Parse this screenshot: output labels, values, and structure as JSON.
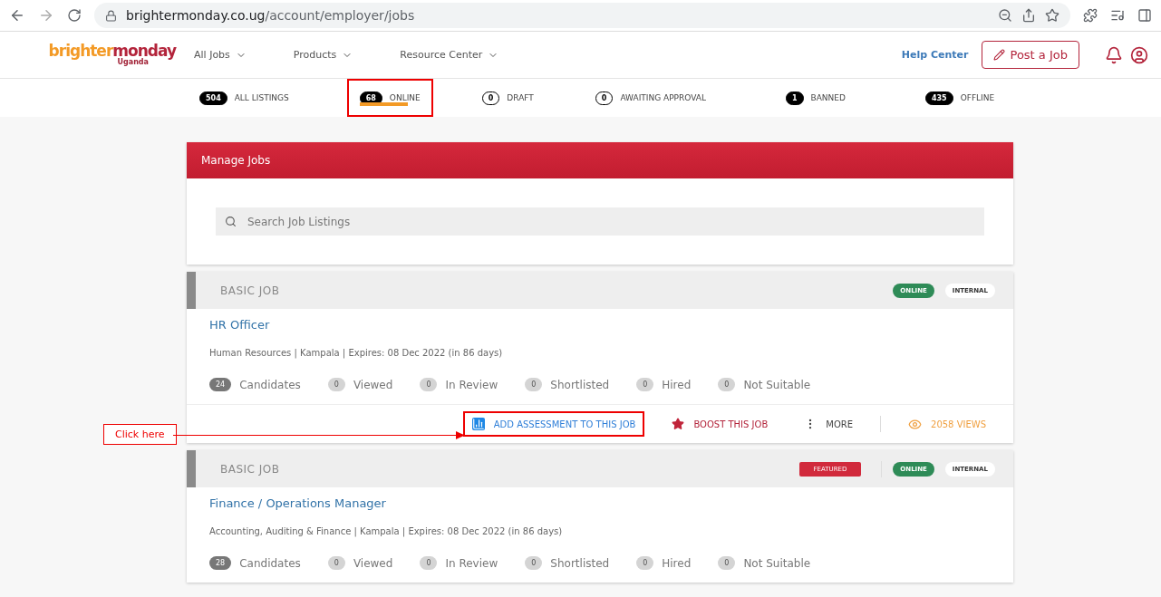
{
  "browser": {
    "url_host": "brightermonday.co.ug",
    "url_path": "/account/employer/jobs"
  },
  "header": {
    "logo": {
      "word1": "brighter",
      "word2": "monday",
      "sub": "Uganda"
    },
    "nav": [
      "All Jobs",
      "Products",
      "Resource Center"
    ],
    "help": "Help Center",
    "post_button": "Post a Job"
  },
  "tabs": [
    {
      "count": "504",
      "label": "ALL LISTINGS",
      "filled": true,
      "selected": false,
      "highlighted": false
    },
    {
      "count": "68",
      "label": "ONLINE",
      "filled": true,
      "selected": true,
      "highlighted": true
    },
    {
      "count": "0",
      "label": "DRAFT",
      "filled": false,
      "selected": false,
      "highlighted": false
    },
    {
      "count": "0",
      "label": "AWAITING APPROVAL",
      "filled": false,
      "selected": false,
      "highlighted": false
    },
    {
      "count": "1",
      "label": "BANNED",
      "filled": true,
      "selected": false,
      "highlighted": false
    },
    {
      "count": "435",
      "label": "OFFLINE",
      "filled": true,
      "selected": false,
      "highlighted": false
    }
  ],
  "manage": {
    "title": "Manage Jobs",
    "search_placeholder": "Search Job Listings"
  },
  "jobs": [
    {
      "type": "BASIC JOB",
      "featured": false,
      "status": "ONLINE",
      "visibility": "INTERNAL",
      "title": "HR Officer",
      "meta": "Human Resources | Kampala | Expires: 08 Dec 2022 (in 86 days)",
      "stats": [
        {
          "count": "24",
          "label": "Candidates",
          "dark": true
        },
        {
          "count": "0",
          "label": "Viewed",
          "dark": false
        },
        {
          "count": "0",
          "label": "In Review",
          "dark": false
        },
        {
          "count": "0",
          "label": "Shortlisted",
          "dark": false
        },
        {
          "count": "0",
          "label": "Hired",
          "dark": false
        },
        {
          "count": "0",
          "label": "Not Suitable",
          "dark": false
        }
      ],
      "actions": [
        {
          "kind": "assessment",
          "label": "ADD ASSESSMENT TO THIS JOB",
          "highlighted": true
        },
        {
          "kind": "boost",
          "label": "BOOST THIS JOB",
          "highlighted": false
        },
        {
          "kind": "more",
          "label": "MORE",
          "highlighted": false
        },
        {
          "kind": "views",
          "label": "2058 VIEWS",
          "highlighted": false
        }
      ]
    },
    {
      "type": "BASIC JOB",
      "featured": true,
      "featured_label": "FEATURED",
      "status": "ONLINE",
      "visibility": "INTERNAL",
      "title": "Finance / Operations Manager",
      "meta": "Accounting, Auditing & Finance | Kampala | Expires: 08 Dec 2022 (in 86 days)",
      "stats": [
        {
          "count": "28",
          "label": "Candidates",
          "dark": true
        },
        {
          "count": "0",
          "label": "Viewed",
          "dark": false
        },
        {
          "count": "0",
          "label": "In Review",
          "dark": false
        },
        {
          "count": "0",
          "label": "Shortlisted",
          "dark": false
        },
        {
          "count": "0",
          "label": "Hired",
          "dark": false
        },
        {
          "count": "0",
          "label": "Not Suitable",
          "dark": false
        }
      ]
    }
  ],
  "annotation": {
    "label": "Click here"
  }
}
